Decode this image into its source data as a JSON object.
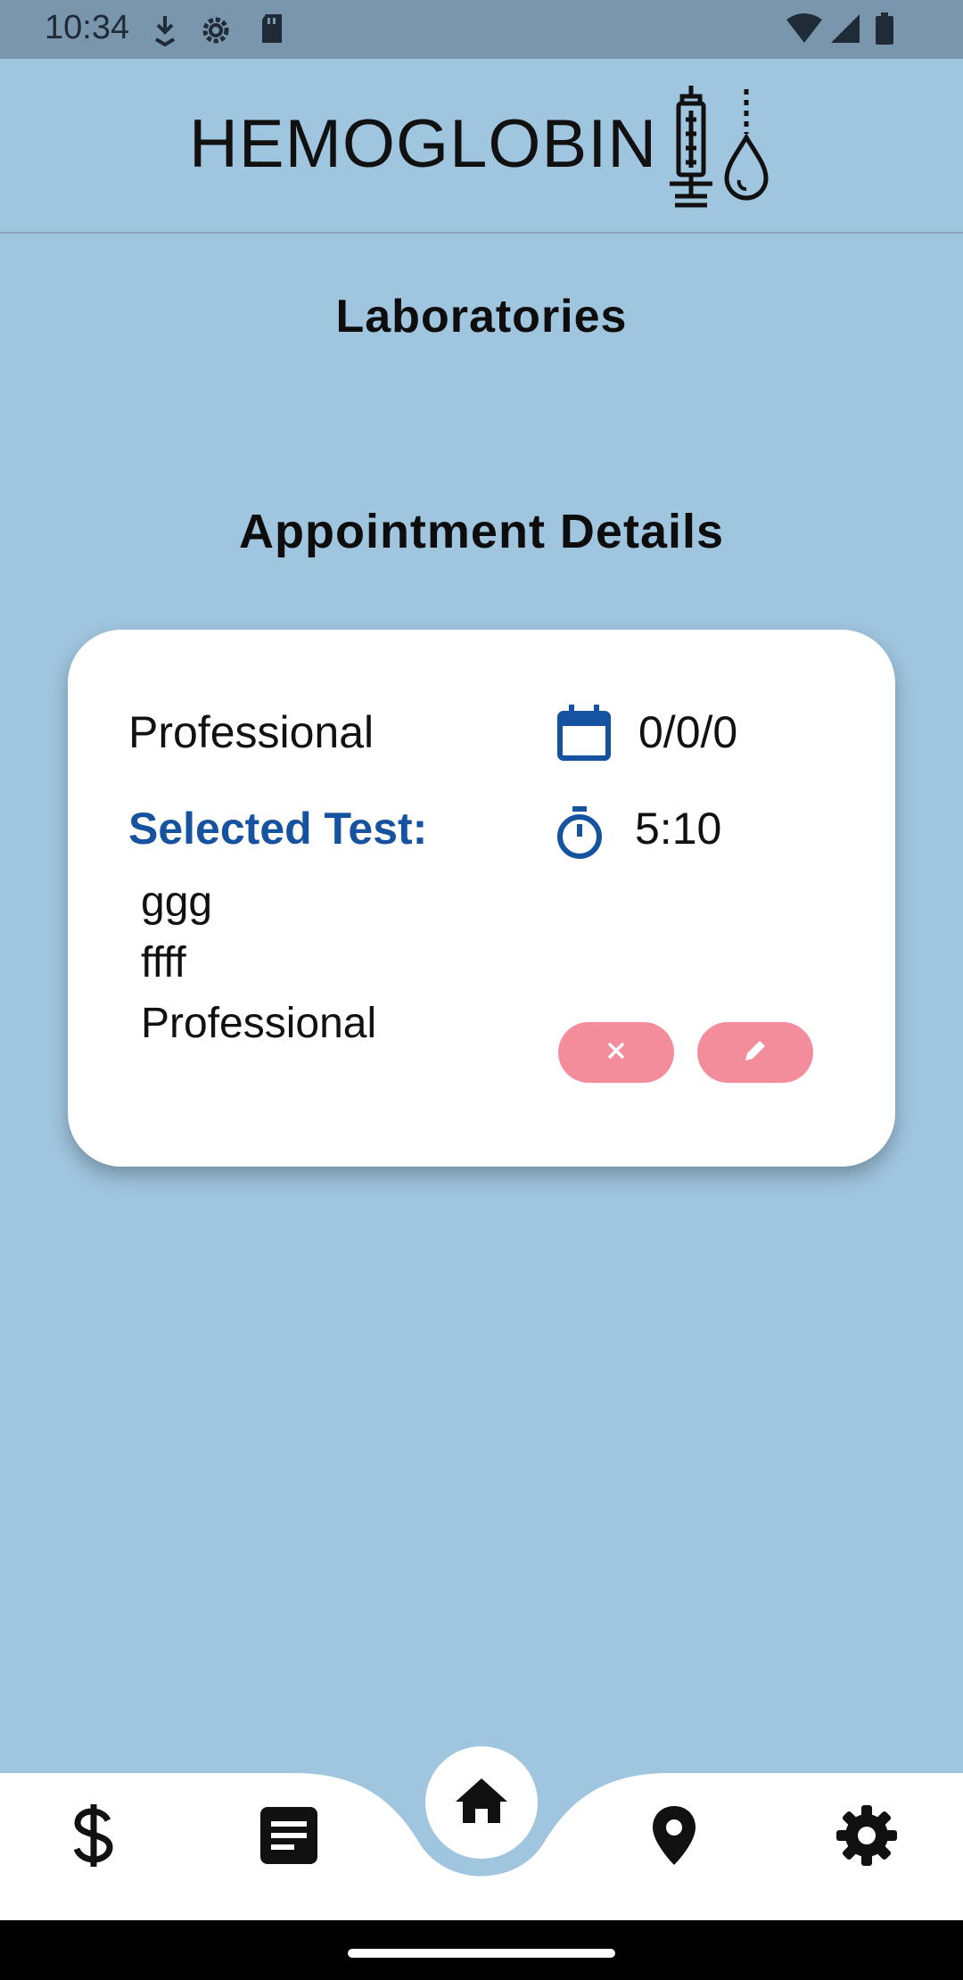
{
  "status_bar": {
    "time": "10:34",
    "icons": [
      "download-icon",
      "settings-gear-icon",
      "sd-card-icon",
      "wifi-icon",
      "signal-icon",
      "battery-icon"
    ]
  },
  "header": {
    "logo_text": "HEMOGLOBIN",
    "logo_icon": "syringe-drop-icon"
  },
  "page": {
    "title": "Laboratories",
    "section_title": "Appointment Details"
  },
  "appointment": {
    "provider": "Professional",
    "selected_test_label": "Selected Test:",
    "tests": [
      "ggg",
      "ffff",
      "Professional"
    ],
    "date": "0/0/0",
    "time": "5:10",
    "date_icon": "calendar-icon",
    "time_icon": "timer-icon",
    "cancel_icon": "close-icon",
    "edit_icon": "pencil-icon"
  },
  "bottom_nav": {
    "items": [
      "dollar-icon",
      "notes-icon",
      "home-icon",
      "location-pin-icon",
      "settings-gear-icon"
    ],
    "active": "home-icon"
  },
  "colors": {
    "background": "#a0c5df",
    "accent_blue": "#1552a0",
    "button_pink": "#f48d9b",
    "card": "#ffffff",
    "status_bar": "#7a96ad"
  }
}
